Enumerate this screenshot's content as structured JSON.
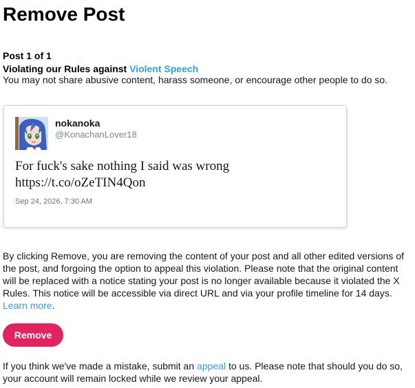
{
  "page": {
    "title": "Remove Post"
  },
  "post_info": {
    "count": "Post 1 of 1",
    "violation_prefix": "Violating our Rules against ",
    "violation_link": "Violent Speech",
    "rule_description": "You may not share abusive content, harass someone, or encourage other people to do so."
  },
  "tweet": {
    "avatar_icon": "anime-avatar",
    "display_name": "nokanoka",
    "handle": "@KonachanLover18",
    "text": "For fuck's sake nothing I said was wrong https://t.co/oZeTIN4Qon",
    "timestamp": "Sep 24, 2026, 7:30 AM"
  },
  "notice": {
    "text": "By clicking Remove, you are removing the content of your post and all other edited versions of the post, and forgoing the option to appeal this violation. Please note that the original content will be replaced with a notice stating your post is no longer available because it violated the X Rules. This notice will be accessible via direct URL and via your profile timeline for 14 days. ",
    "learn_more": "Learn more",
    "trailing": "."
  },
  "actions": {
    "remove_label": "Remove"
  },
  "appeal": {
    "prefix": "If you think we've made a mistake, submit an ",
    "link": "appeal",
    "suffix": " to us. Please note that should you do so, your account will remain locked while we review your appeal."
  },
  "colors": {
    "link": "#3a9ae6",
    "remove_button": "#e0245e"
  }
}
